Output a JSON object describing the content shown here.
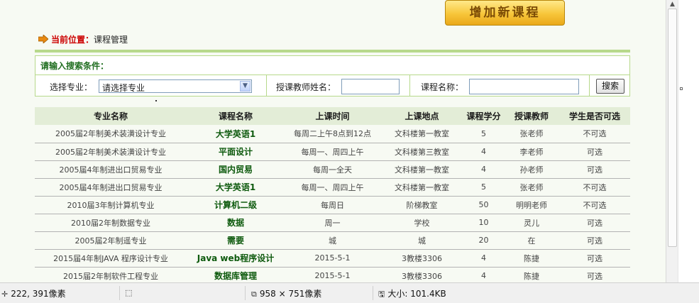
{
  "toolbar": {
    "add_course_label": "增加新课程"
  },
  "location": {
    "label": "当前位置：",
    "value": "课程管理"
  },
  "search": {
    "title": "请输入搜索条件：",
    "major_label": "选择专业：",
    "major_selected": "请选择专业",
    "teacher_label": "授课教师姓名：",
    "teacher_value": "",
    "course_label": "课程名称：",
    "course_value": "",
    "button_label": "搜索"
  },
  "table": {
    "headers": [
      "专业名称",
      "课程名称",
      "上课时间",
      "上课地点",
      "课程学分",
      "授课教师",
      "学生是否可选"
    ],
    "rows": [
      [
        "2005届2年制美术装潢设计专业",
        "大学英语1",
        "每周二上午8点到12点",
        "文科楼第一教室",
        "5",
        "张老师",
        "不可选"
      ],
      [
        "2005届2年制美术装潢设计专业",
        "平面设计",
        "每周一、周四上午",
        "文科楼第三教室",
        "4",
        "李老师",
        "可选"
      ],
      [
        "2005届4年制进出口贸易专业",
        "国内贸易",
        "每周一全天",
        "文科楼第一教室",
        "4",
        "孙老师",
        "可选"
      ],
      [
        "2005届4年制进出口贸易专业",
        "大学英语1",
        "每周一、周四上午",
        "文科楼第一教室",
        "5",
        "张老师",
        "不可选"
      ],
      [
        "2010届3年制计算机专业",
        "计算机二级",
        "每周日",
        "阶梯教室",
        "50",
        "明明老师",
        "不可选"
      ],
      [
        "2010届2年制数据专业",
        "数据",
        "周一",
        "学校",
        "10",
        "灵儿",
        "可选"
      ],
      [
        "2005届2年制遥专业",
        "需要",
        "城",
        "城",
        "20",
        "在",
        "可选"
      ],
      [
        "2015届4年制JAVA 程序设计专业",
        "Java web程序设计",
        "2015-5-1",
        "3教楼3306",
        "4",
        "陈捷",
        "可选"
      ],
      [
        "2015届2年制软件工程专业",
        "数据库管理",
        "2015-5-1",
        "3教楼3306",
        "4",
        "陈捷",
        "可选"
      ]
    ]
  },
  "statusbar": {
    "cursor_pos": "222, 391像素",
    "selection_icon": "selection-icon",
    "image_size": "958 × 751像素",
    "file_size": "大小: 101.4KB"
  },
  "colors": {
    "accent_green": "#b7d98b",
    "header_bg": "#e3edd7",
    "course_text": "#0e5a0e",
    "location_red": "#cc0000"
  }
}
